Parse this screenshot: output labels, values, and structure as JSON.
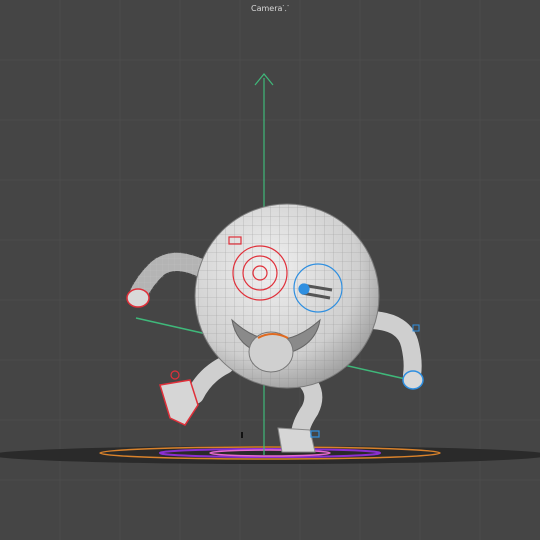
{
  "viewport": {
    "camera_label": "Camera⸪",
    "background": "#454545",
    "grid_color": "#4d4d4d",
    "axis_color": "#3fb87a",
    "mesh_fill": "#d9d9d9",
    "wire_color": "#7a7a7a",
    "control_left_color": "#e0303a",
    "control_right_color": "#2f8fe0",
    "ground_ring_colors": [
      "#d9822b",
      "#8b2fd1",
      "#e86ad0"
    ]
  },
  "scene": {
    "character": "round-emoji-rig",
    "mesh_display": "wireframe-on-shaded"
  }
}
